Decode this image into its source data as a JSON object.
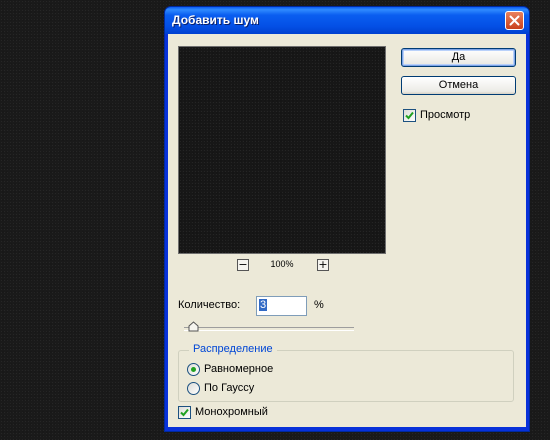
{
  "dialog": {
    "title": "Добавить шум",
    "buttons": {
      "ok_label": "Да",
      "cancel_label": "Отмена"
    },
    "preview": {
      "checkbox_label": "Просмотр",
      "checked": true,
      "zoom_label": "100%",
      "zoom_out_symbol": "−",
      "zoom_in_symbol": "+"
    },
    "amount": {
      "label": "Количество:",
      "value": "3",
      "unit": "%",
      "slider_percent": 3
    },
    "distribution": {
      "legend": "Распределение",
      "options": [
        {
          "label": "Равномерное",
          "selected": true
        },
        {
          "label": "По Гауссу",
          "selected": false
        }
      ]
    },
    "monochrome": {
      "label": "Монохромный",
      "checked": true
    }
  },
  "colors": {
    "titlebar": "#0450e6",
    "dialog_bg": "#ece9d8",
    "accent_legend": "#0046d5",
    "check_green": "#21a121"
  }
}
